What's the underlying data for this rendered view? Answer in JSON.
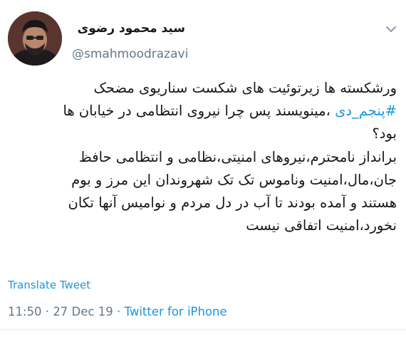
{
  "author": {
    "display_name": "سید محمود رضوی",
    "handle": "@smahmoodrazavi"
  },
  "tweet": {
    "lines": [
      {
        "text": "ورشکسته ها زیرتوئیت های شکست سناریوی مضحک"
      },
      {
        "hashtag": "#پنجم_دی",
        "text": " ،مینویسند پس چرا نیروی انتظامی در خیابان ها"
      },
      {
        "text": "بود؟"
      },
      {
        "text": "برانداز نامحترم،نیروهای امنیتی،نظامی و انتظامی حافظ"
      },
      {
        "text": "جان،مال،امنیت وناموس تک تک شهروندان این مرز و بوم"
      },
      {
        "text": "هستند و آمده بودند تا آب در دل مردم و نوامیس آنها تکان"
      },
      {
        "text": "نخورد،امنیت اتفاقی نیست"
      }
    ]
  },
  "translate_label": "Translate Tweet",
  "meta": {
    "time": "11:50",
    "separator1": " · ",
    "date": "27 Dec 19",
    "separator2": " · ",
    "source": "Twitter for iPhone"
  },
  "icons": {
    "menu": "chevron-down-icon",
    "avatar": "avatar"
  },
  "colors": {
    "link": "#1b95e0",
    "text": "#14171a",
    "secondary": "#657786"
  }
}
